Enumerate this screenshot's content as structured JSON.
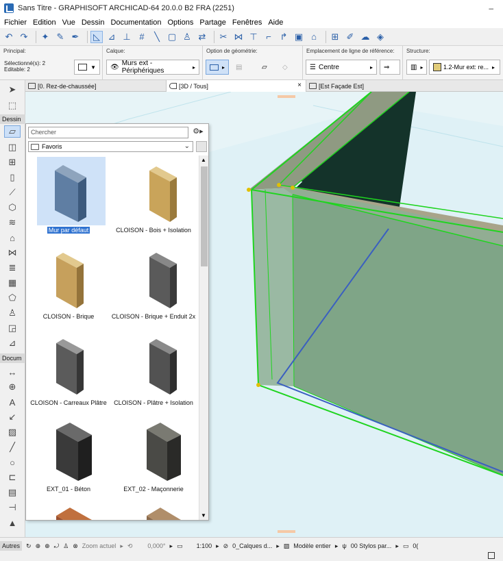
{
  "window": {
    "title": "Sans Titre - GRAPHISOFT ARCHICAD-64 20.0.0 B2 FRA (2251)",
    "minimize": "–"
  },
  "menu": [
    "Fichier",
    "Edition",
    "Vue",
    "Dessin",
    "Documentation",
    "Options",
    "Partage",
    "Fenêtres",
    "Aide"
  ],
  "infobox": {
    "principal_label": "Principal:",
    "selection_line1": "Sélectionné(s): 2",
    "selection_line2": "Editable: 2",
    "calque_label": "Calque:",
    "calque_value": "Murs ext - Périphériques",
    "geom_label": "Option de géométrie:",
    "ref_label": "Emplacement de ligne de référence:",
    "ref_value": "Centre",
    "structure_label": "Structure:",
    "structure_value": "1.2-Mur ext: re..."
  },
  "toolbox": {
    "dessin_label": "Dessin",
    "docum_label": "Docum",
    "autres_label": "Autres"
  },
  "tabs": {
    "tab1": "[0. Rez-de-chaussée]",
    "tab2": "[3D / Tous]",
    "tab3": "[Est Façade Est]",
    "close": "×"
  },
  "favorites": {
    "search_placeholder": "Chercher",
    "folder": "Favoris",
    "items": [
      {
        "label": "Mur par défaut",
        "color": "#5f7ea3",
        "selected": true
      },
      {
        "label": "CLOISON - Bois + Isolation",
        "color": "#c9a45a"
      },
      {
        "label": "CLOISON - Brique",
        "color": "#c6a05c"
      },
      {
        "label": "CLOISON - Brique + Enduit 2x",
        "color": "#5a5a5a"
      },
      {
        "label": "CLOISON - Carreaux Plâtre",
        "color": "#5b5b5b"
      },
      {
        "label": "CLOISON - Plâtre + Isolation",
        "color": "#525252"
      },
      {
        "label": "EXT_01 - Béton",
        "color": "#3a3a3a"
      },
      {
        "label": "EXT_02 - Maçonnerie",
        "color": "#4a4a46"
      },
      {
        "label": "",
        "color": "#9a4f2e"
      },
      {
        "label": "",
        "color": "#8a6a4c"
      }
    ]
  },
  "statusbar": {
    "zoom": "Zoom actuel",
    "angle": "0,000°",
    "scale": "1:100",
    "layers": "0_Calques d...",
    "model": "Modèle entier",
    "pens": "00 Stylos par...",
    "last": "0("
  },
  "colors": {
    "accent": "#2f72d0",
    "selection_green": "#1fd41f",
    "view_bg": "#e7f4f7"
  }
}
